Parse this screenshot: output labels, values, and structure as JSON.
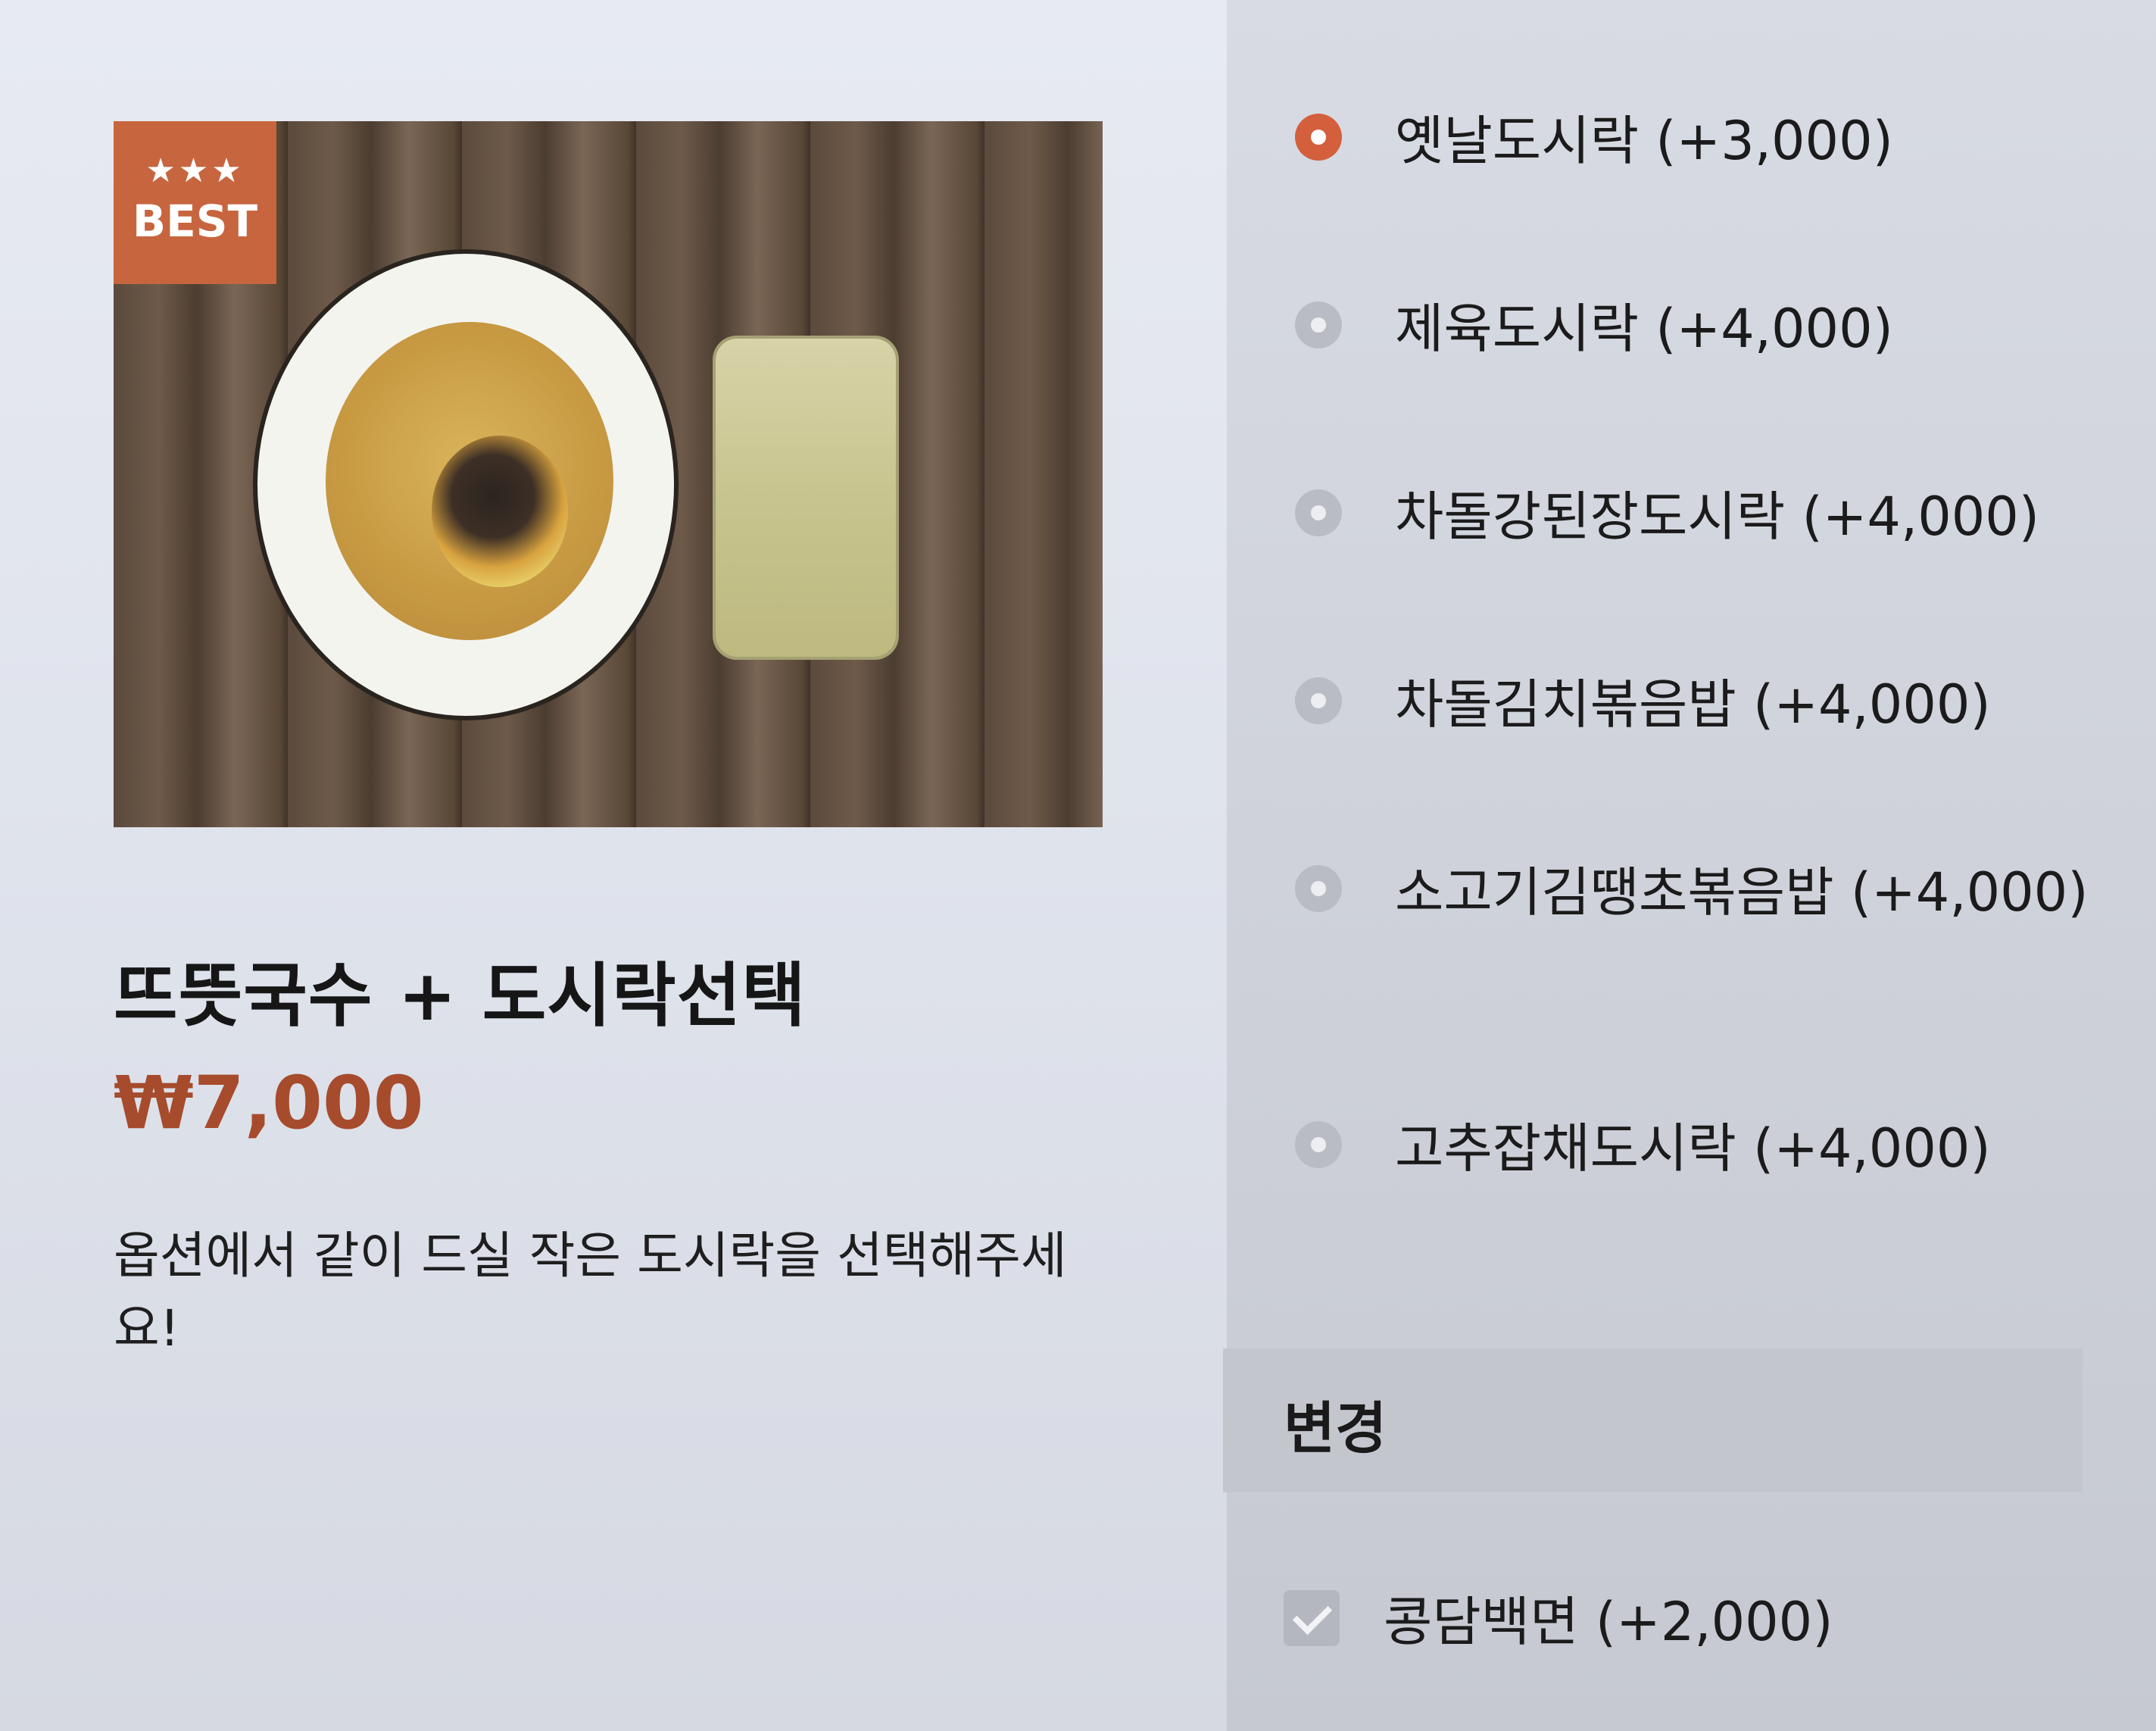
{
  "product": {
    "badge_stars": "★★★",
    "badge_text": "BEST",
    "title": "뜨뜻국수 + 도시락선택",
    "price": "₩7,000",
    "description": "옵션에서 같이 드실 작은 도시락을 선택해주세요!"
  },
  "options": [
    {
      "label": "옛날도시락 (+3,000)",
      "selected": true
    },
    {
      "label": "제육도시락 (+4,000)",
      "selected": false
    },
    {
      "label": "차돌강된장도시락 (+4,000)",
      "selected": false
    },
    {
      "label": "차돌김치볶음밥 (+4,000)",
      "selected": false
    },
    {
      "label": "소고기김땡초볶음밥 (+4,000)",
      "selected": false
    },
    {
      "label": "고추잡채도시락 (+4,000)",
      "selected": false
    }
  ],
  "change_section": {
    "title": "변경",
    "items": [
      {
        "label": "콩담백면 (+2,000)",
        "checked": true
      }
    ]
  },
  "colors": {
    "accent": "#d45f3c",
    "price": "#a64b2c",
    "badge": "#c7653f"
  }
}
